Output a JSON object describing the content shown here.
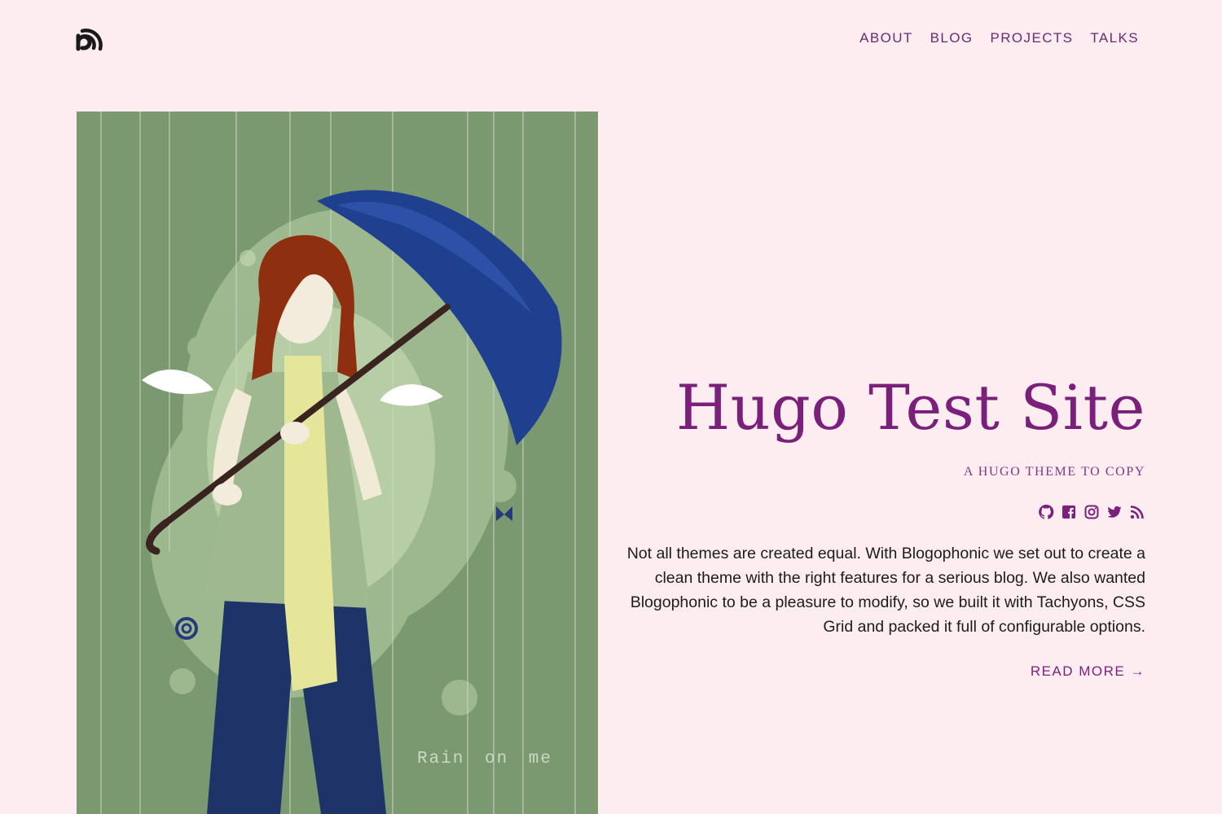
{
  "header": {
    "logo_icon": "blogophonic-logo-icon",
    "nav": [
      {
        "label": "ABOUT"
      },
      {
        "label": "BLOG"
      },
      {
        "label": "PROJECTS"
      },
      {
        "label": "TALKS"
      }
    ]
  },
  "hero": {
    "image_caption": "Rain on me",
    "title": "Hugo Test Site",
    "subtitle": "A HUGO THEME TO COPY",
    "social_icons": [
      "github-icon",
      "facebook-icon",
      "instagram-icon",
      "twitter-icon",
      "rss-icon"
    ],
    "description": "Not all themes are created equal. With Blogophonic we set out to create a clean theme with the right features for a serious blog. We also wanted Blogophonic to be a pleasure to modify, so we built it with Tachyons, CSS Grid and packed it full of configurable options.",
    "read_more": "READ MORE →"
  },
  "colors": {
    "background": "#fdedf0",
    "accent": "#7a1f7a",
    "nav": "#6b2a72",
    "image_bg": "#7b9970"
  }
}
